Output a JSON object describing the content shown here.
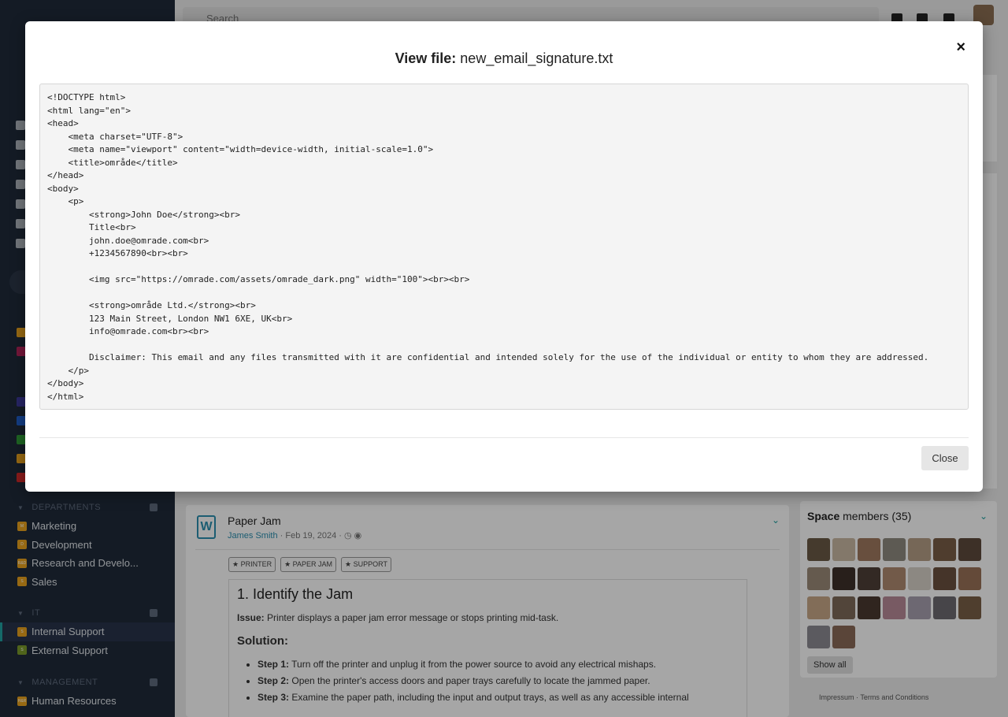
{
  "topbar": {
    "search_placeholder": "Search"
  },
  "sidebar": {
    "departments": {
      "heading": "DEPARTMENTS",
      "items": [
        {
          "label": "Marketing",
          "badge": "M",
          "color": "#e8a21e"
        },
        {
          "label": "Development",
          "badge": "D",
          "color": "#e8a21e"
        },
        {
          "label": "Research and Develo...",
          "badge": "R&D",
          "color": "#e8a21e"
        },
        {
          "label": "Sales",
          "badge": "S",
          "color": "#e8a21e"
        }
      ]
    },
    "it": {
      "heading": "IT",
      "items": [
        {
          "label": "Internal Support",
          "badge": "S",
          "color": "#e8a21e"
        },
        {
          "label": "External Support",
          "badge": "S",
          "color": "#7a9a2a"
        }
      ]
    },
    "management": {
      "heading": "MANAGEMENT",
      "items": [
        {
          "label": "Human Resources",
          "badge": "H&R",
          "color": "#e8a21e"
        }
      ]
    }
  },
  "post": {
    "title": "Paper Jam",
    "author": "James Smith",
    "date": "· Feb 19, 2024 ·",
    "tags": [
      "PRINTER",
      "PAPER JAM",
      "SUPPORT"
    ],
    "article": {
      "heading": "1. Identify the Jam",
      "issue_label": "Issue:",
      "issue_text": "Printer displays a paper jam error message or stops printing mid-task.",
      "solution_heading": "Solution:",
      "steps": [
        {
          "label": "Step 1:",
          "text": "Turn off the printer and unplug it from the power source to avoid any electrical mishaps."
        },
        {
          "label": "Step 2:",
          "text": "Open the printer's access doors and paper trays carefully to locate the jammed paper."
        },
        {
          "label": "Step 3:",
          "text": "Examine the paper path, including the input and output trays, as well as any accessible internal"
        }
      ]
    }
  },
  "members": {
    "title_bold": "Space",
    "title_rest": "members (35)",
    "show_all": "Show all"
  },
  "footer": {
    "impressum": "Impressum",
    "separator": "·",
    "terms": "Terms and Conditions"
  },
  "modal": {
    "title_label": "View file:",
    "filename": "new_email_signature.txt",
    "close_icon": "×",
    "close_button": "Close",
    "code": "<!DOCTYPE html>\n<html lang=\"en\">\n<head>\n    <meta charset=\"UTF-8\">\n    <meta name=\"viewport\" content=\"width=device-width, initial-scale=1.0\">\n    <title>område</title>\n</head>\n<body>\n    <p>\n        <strong>John Doe</strong><br>\n        Title<br>\n        john.doe@omrade.com<br>\n        +1234567890<br><br>\n\n        <img src=\"https://omrade.com/assets/omrade_dark.png\" width=\"100\"><br><br>\n\n        <strong>område Ltd.</strong><br>\n        123 Main Street, London NW1 6XE, UK<br>\n        info@omrade.com<br><br>\n\n        Disclaimer: This email and any files transmitted with it are confidential and intended solely for the use of the individual or entity to whom they are addressed.\n    </p>\n</body>\n</html>"
  }
}
